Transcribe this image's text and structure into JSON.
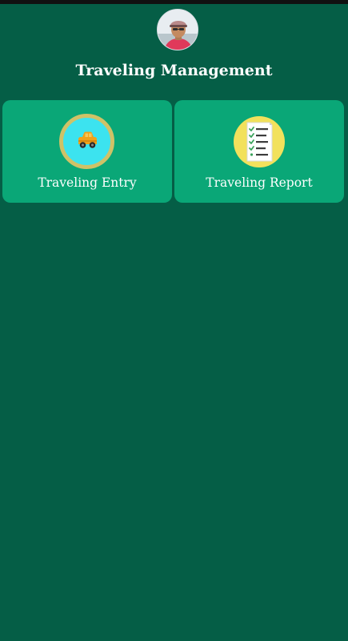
{
  "header": {
    "avatar_icon": "user-avatar-photo",
    "title": "Traveling Management"
  },
  "menu": [
    {
      "label": "Traveling Entry",
      "icon": "car-icon"
    },
    {
      "label": "Traveling Report",
      "icon": "checklist-report-icon"
    }
  ],
  "colors": {
    "background": "#055e46",
    "card": "#0aa777",
    "text": "#ffffff",
    "car_icon_bg": "#3ce3ef",
    "car_icon_ring": "#cfc267",
    "report_icon_bg": "#f2e15c"
  }
}
